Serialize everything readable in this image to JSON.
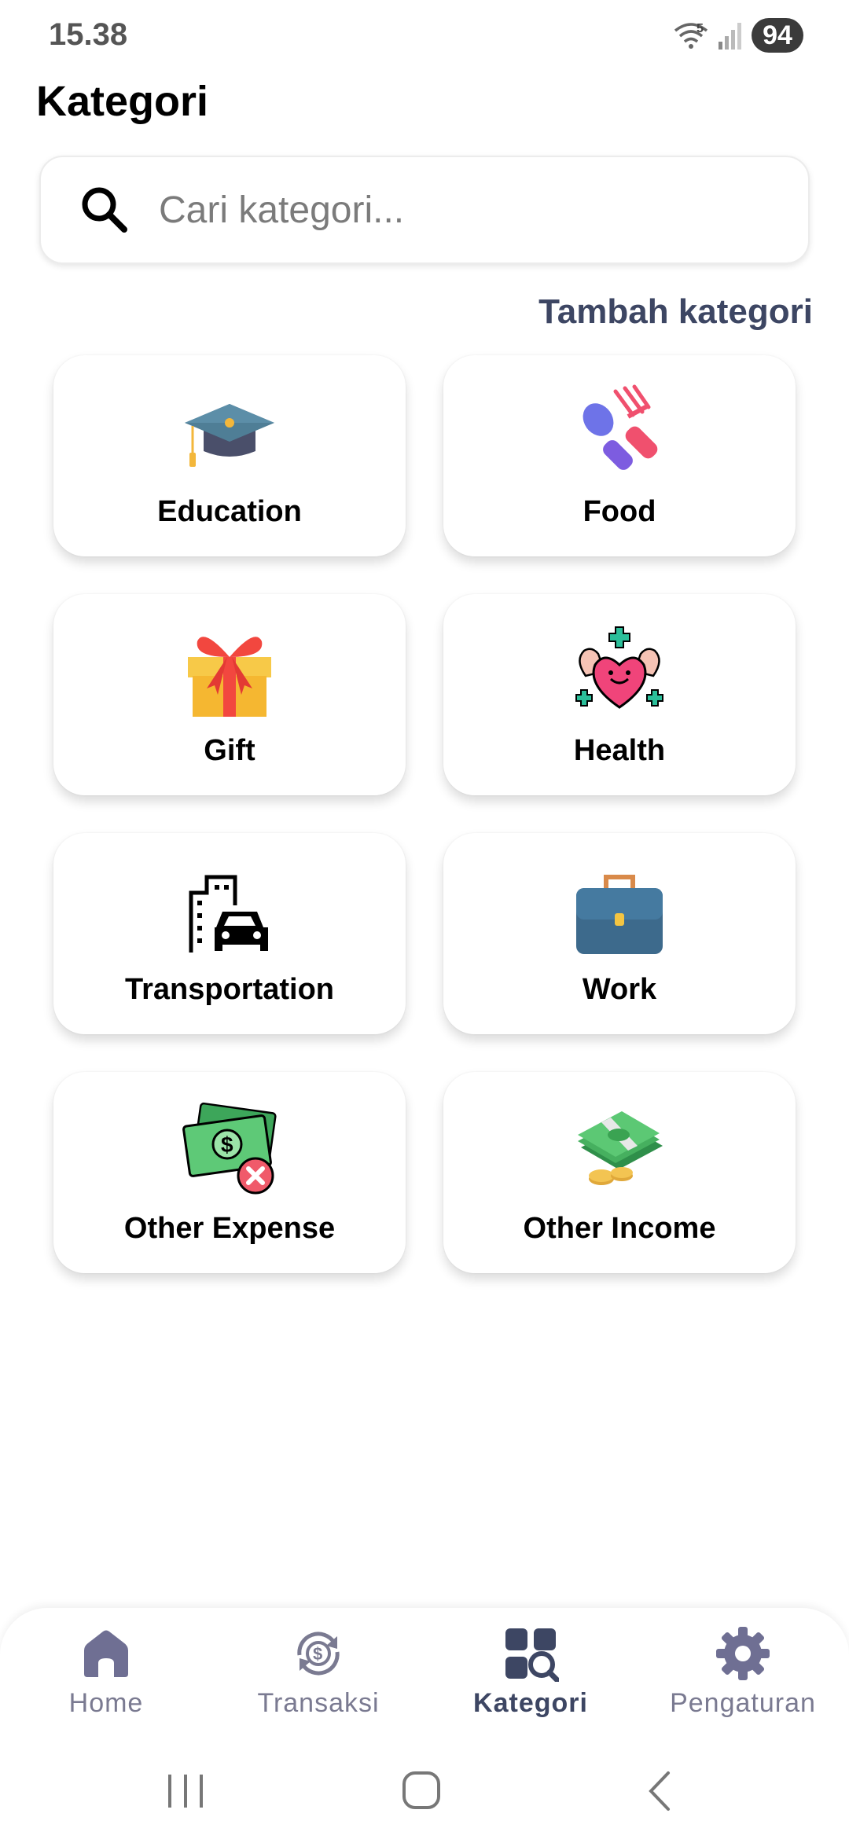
{
  "status": {
    "time": "15.38",
    "battery": "94",
    "wifi_label": "5"
  },
  "header": {
    "title": "Kategori"
  },
  "search": {
    "placeholder": "Cari kategori..."
  },
  "add_category_label": "Tambah kategori",
  "categories": [
    {
      "label": "Education",
      "icon": "graduation-cap-icon"
    },
    {
      "label": "Food",
      "icon": "spoon-fork-icon"
    },
    {
      "label": "Gift",
      "icon": "gift-box-icon"
    },
    {
      "label": "Health",
      "icon": "heart-muscle-icon"
    },
    {
      "label": "Transportation",
      "icon": "car-building-icon"
    },
    {
      "label": "Work",
      "icon": "briefcase-icon"
    },
    {
      "label": "Other Expense",
      "icon": "money-remove-icon"
    },
    {
      "label": "Other Income",
      "icon": "money-stack-icon"
    }
  ],
  "bottom_nav": {
    "items": [
      {
        "label": "Home",
        "icon": "home-icon",
        "active": false
      },
      {
        "label": "Transaksi",
        "icon": "transaction-icon",
        "active": false
      },
      {
        "label": "Kategori",
        "icon": "category-search-icon",
        "active": true
      },
      {
        "label": "Pengaturan",
        "icon": "gear-icon",
        "active": false
      }
    ]
  },
  "colors": {
    "accent": "#3d4663",
    "inactive": "#7a7a91",
    "nav_icon": "#6f6f93"
  }
}
